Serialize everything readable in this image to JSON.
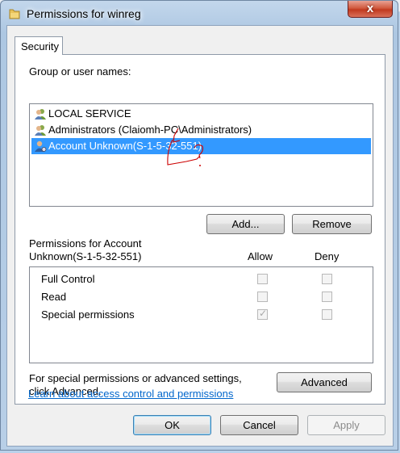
{
  "window": {
    "title": "Permissions for winreg",
    "close_glyph": "x"
  },
  "tab": {
    "label": "Security"
  },
  "group_label": "Group or user names:",
  "users": [
    {
      "name": "LOCAL SERVICE",
      "icon": "users-icon"
    },
    {
      "name": "Administrators (Claiomh-PC\\Administrators)",
      "icon": "users-icon"
    },
    {
      "name": "Account Unknown(S-1-5-32-551)",
      "icon": "unknown-user-icon"
    }
  ],
  "selected_user_index": 2,
  "buttons": {
    "add": "Add...",
    "remove": "Remove",
    "advanced": "Advanced",
    "ok": "OK",
    "cancel": "Cancel",
    "apply": "Apply"
  },
  "permissions_header": {
    "line1": "Permissions for Account",
    "line2": "Unknown(S-1-5-32-551)",
    "allow": "Allow",
    "deny": "Deny"
  },
  "permissions": [
    {
      "name": "Full Control",
      "allow": false,
      "deny": false
    },
    {
      "name": "Read",
      "allow": false,
      "deny": false
    },
    {
      "name": "Special permissions",
      "allow": true,
      "deny": false
    }
  ],
  "advanced_text": {
    "line1": "For special permissions or advanced settings,",
    "line2": "click Advanced."
  },
  "learn_link": "Learn about access control and permissions",
  "colors": {
    "selection": "#3399ff",
    "link": "#0066cc",
    "annotation": "#cc0000"
  }
}
